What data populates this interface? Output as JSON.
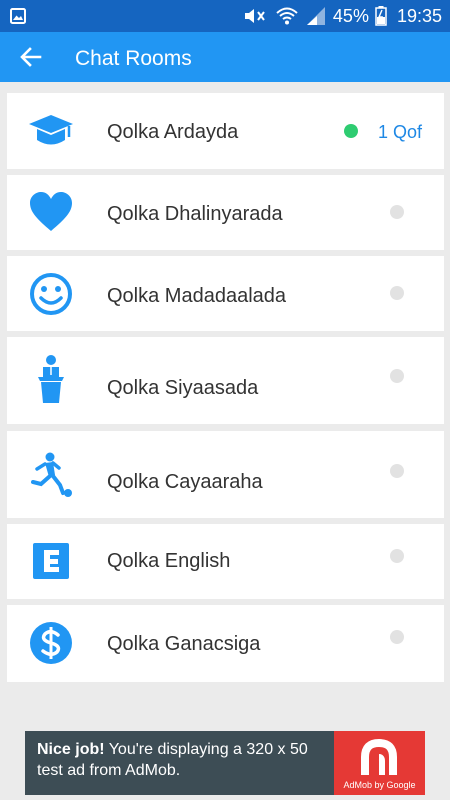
{
  "status_bar": {
    "battery": "45%",
    "time": "19:35",
    "icons": [
      "image-icon",
      "mute-icon",
      "wifi-icon",
      "signal-icon",
      "battery-icon"
    ]
  },
  "app_bar": {
    "title": "Chat Rooms",
    "back_icon": "arrow-left-icon"
  },
  "rooms": [
    {
      "name": "Qolka Ardayda",
      "icon": "graduation-cap-icon",
      "online": true,
      "count": "1 Qof"
    },
    {
      "name": "Qolka Dhalinyarada",
      "icon": "heart-icon",
      "online": false
    },
    {
      "name": "Qolka Madadaalada",
      "icon": "smiley-icon",
      "online": false
    },
    {
      "name": "Qolka Siyaasada",
      "icon": "podium-speaker-icon",
      "online": false
    },
    {
      "name": "Qolka Cayaaraha",
      "icon": "soccer-player-icon",
      "online": false
    },
    {
      "name": "Qolka English",
      "icon": "letter-e-icon",
      "online": false
    },
    {
      "name": "Qolka Ganacsiga",
      "icon": "dollar-icon",
      "online": false
    }
  ],
  "ad": {
    "bold": "Nice job!",
    "text": " You're displaying a 320 x 50 test ad from AdMob.",
    "brand": "AdMob by Google"
  },
  "colors": {
    "status_bar": "#1565c0",
    "app_bar": "#2196f3",
    "icon": "#2196f3",
    "online_dot": "#2ecc71",
    "offline_dot": "#e2e2e2",
    "count_text": "#1e88e5",
    "ad_background": "#3d4d55",
    "ad_logo": "#e53935"
  }
}
